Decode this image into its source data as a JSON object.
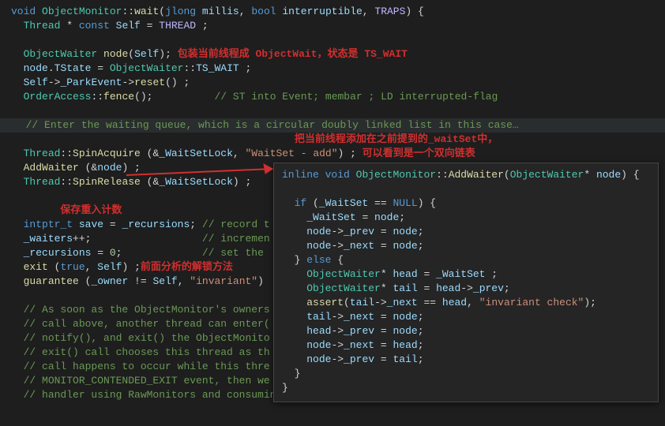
{
  "main": {
    "l0": "void ObjectMonitor::wait(jlong millis, bool interruptible, TRAPS) {",
    "l1": "  Thread * const Self = THREAD ;",
    "l2": "",
    "l3": "  ObjectWaiter node(Self); ",
    "l4": "  node.TState = ObjectWaiter::TS_WAIT ;",
    "l5": "  Self->_ParkEvent->reset() ;",
    "l6": "  OrderAccess::fence();          // ST into Event; membar ; LD interrupted-flag",
    "l7": "",
    "l8": "  // Enter the waiting queue, which is a circular doubly linked list in this case…",
    "l9": "",
    "l10": "  Thread::SpinAcquire (&_WaitSetLock, \"WaitSet - add\") ;",
    "l11": "  AddWaiter (&node) ;",
    "l12": "  Thread::SpinRelease (&_WaitSetLock) ;",
    "l13": "",
    "l14": "",
    "l15": "  intptr_t save = _recursions; // record t",
    "l16": "  _waiters++;                  // incremen",
    "l17": "  _recursions = 0;             // set the",
    "l18": "  exit (true, Self) ;",
    "l19": "  guarantee (_owner != Self, \"invariant\")",
    "l20": "",
    "l21": "  // As soon as the ObjectMonitor's owners",
    "l22": "  // call above, another thread can enter(",
    "l23": "  // notify(), and exit() the ObjectMonito",
    "l24": "  // exit() call chooses this thread as th",
    "l25": "  // call happens to occur while this thre",
    "l26": "  // MONITOR_CONTENDED_EXIT event, then we",
    "l27": "  // handler using RawMonitors and consuming the unpark()."
  },
  "annotations": {
    "a1": "包装当前线程成 ObjectWait，状态是 TS_WAIT",
    "a2_line1": "把当前线程添加在之前提到的_waitSet中，",
    "a2_line2": "可以看到是一个双向链表",
    "a3": "保存重入计数",
    "a4": "前面分析的解锁方法"
  },
  "hover": {
    "h0": "inline void ObjectMonitor::AddWaiter(ObjectWaiter* node) {",
    "h1": "",
    "h2": "  if (_WaitSet == NULL) {",
    "h3": "    _WaitSet = node;",
    "h4": "    node->_prev = node;",
    "h5": "    node->_next = node;",
    "h6": "  } else {",
    "h7": "    ObjectWaiter* head = _WaitSet ;",
    "h8": "    ObjectWaiter* tail = head->_prev;",
    "h9": "    assert(tail->_next == head, \"invariant check\");",
    "h10": "    tail->_next = node;",
    "h11": "    head->_prev = node;",
    "h12": "    node->_next = head;",
    "h13": "    node->_prev = tail;",
    "h14": "  }",
    "h15": "}"
  }
}
